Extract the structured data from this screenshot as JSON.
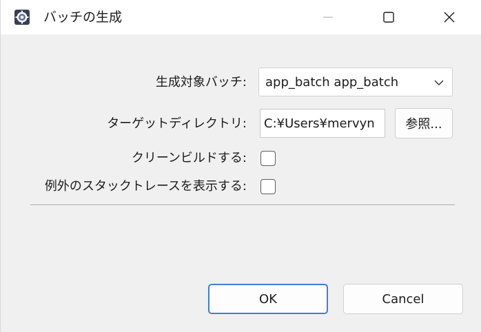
{
  "window": {
    "title": "バッチの生成"
  },
  "form": {
    "target_batch_label": "生成対象バッチ:",
    "target_batch_value": "app_batch app_batch",
    "target_dir_label": "ターゲットディレクトリ:",
    "target_dir_value": "C:¥Users¥mervyn",
    "browse_label": "参照...",
    "clean_build_label": "クリーンビルドする:",
    "clean_build_checked": false,
    "show_stacktrace_label": "例外のスタックトレースを表示する:",
    "show_stacktrace_checked": false
  },
  "buttons": {
    "ok_label": "OK",
    "cancel_label": "Cancel"
  },
  "icons": {
    "app": "app-gear-icon",
    "minimize": "minimize-icon",
    "maximize": "maximize-icon",
    "close": "close-icon",
    "dropdown": "chevron-down-icon"
  }
}
